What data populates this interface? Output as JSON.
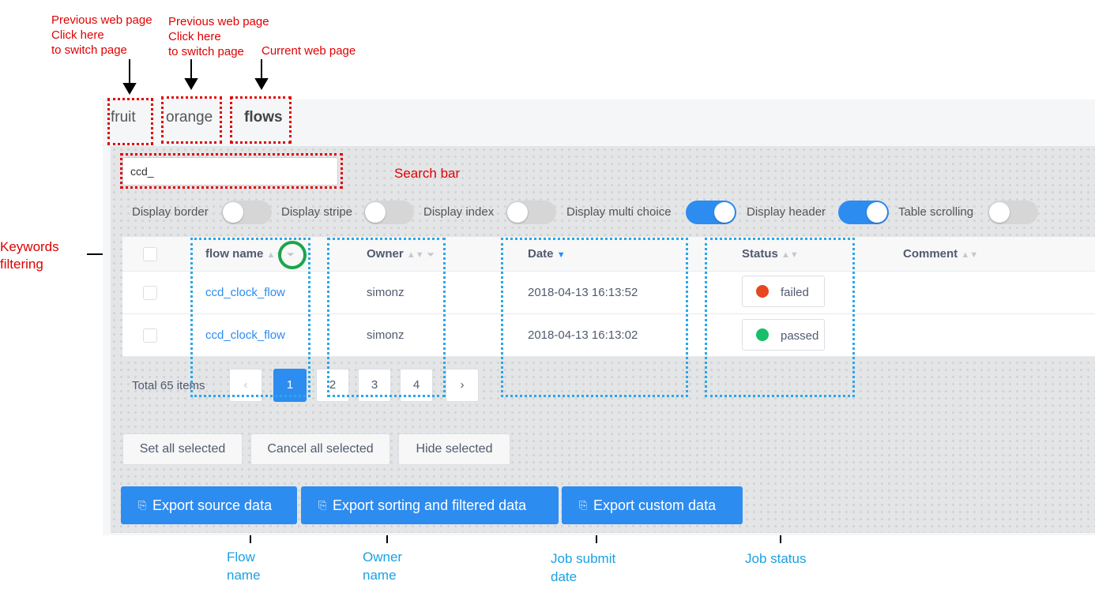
{
  "annotations": {
    "prev_page_1": "Previous web page\nClick here\nto switch page",
    "prev_page_2": "Previous web page\nClick here\nto switch page",
    "current_page": "Current web page",
    "search_bar": "Search bar",
    "keywords_filtering": "Keywords\n filtering",
    "flow_name": "Flow\nname",
    "owner_name": "Owner\nname",
    "job_submit_date": "Job submit\ndate",
    "job_status": "Job status"
  },
  "tabs": [
    "fruit",
    "orange",
    "flows"
  ],
  "active_tab": "flows",
  "search": {
    "value": "ccd_"
  },
  "toggles": [
    {
      "label": "Display border",
      "on": false
    },
    {
      "label": "Display stripe",
      "on": false
    },
    {
      "label": "Display index",
      "on": false
    },
    {
      "label": "Display multi choice",
      "on": true
    },
    {
      "label": "Display header",
      "on": true
    },
    {
      "label": "Table scrolling",
      "on": false
    }
  ],
  "table": {
    "columns": [
      "flow name",
      "Owner",
      "Date",
      "Status",
      "Comment"
    ],
    "rows": [
      {
        "flow": "ccd_clock_flow",
        "owner": "simonz",
        "date": "2018-04-13 16:13:52",
        "status": "failed",
        "status_color": "#e8461e"
      },
      {
        "flow": "ccd_clock_flow",
        "owner": "simonz",
        "date": "2018-04-13 16:13:02",
        "status": "passed",
        "status_color": "#19be6b"
      }
    ]
  },
  "pagination": {
    "total": "Total 65 items",
    "prev": "‹",
    "pages": [
      "1",
      "2",
      "3",
      "4"
    ],
    "current": "1",
    "next": "›"
  },
  "actions": {
    "set_all": "Set all selected",
    "cancel_all": "Cancel all selected",
    "hide": "Hide selected"
  },
  "exports": {
    "icon": "download-icon",
    "source": "Export source data",
    "sorted": "Export sorting and filtered data",
    "custom": "Export custom data"
  },
  "colors": {
    "accent": "#2d8cf0",
    "annotation_red": "#e00000",
    "annotation_blue": "#1ba1e2"
  }
}
